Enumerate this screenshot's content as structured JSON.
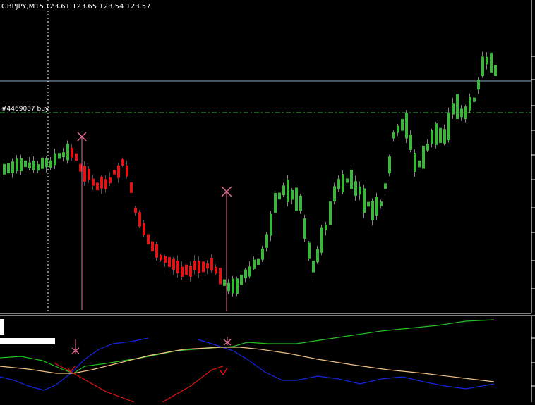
{
  "header": {
    "symbol": "GBPJPY,M15",
    "ohlc": "123.61 123.65 123.54 123.57"
  },
  "order": {
    "label": "#4469087 buy"
  },
  "colors": {
    "background": "#000000",
    "bull": "#3cb53c",
    "bear": "#e01414",
    "order_line": "#3cb53c",
    "price_line": "#8aa8c8",
    "marker": "#f06ea0",
    "ind_green": "#22c022",
    "ind_blue": "#1426e0",
    "ind_red": "#e01414",
    "ind_orange": "#f0c080"
  },
  "icons": {
    "signal_marker": "x-cross-icon",
    "check_marker": "check-icon"
  }
}
